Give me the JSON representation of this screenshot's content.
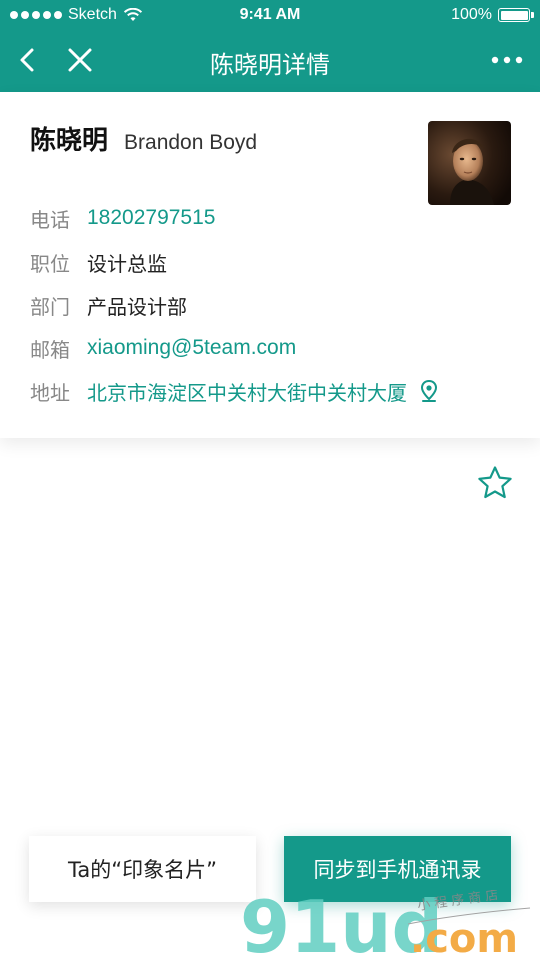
{
  "status_bar": {
    "carrier": "Sketch",
    "time": "9:41 AM",
    "battery": "100%"
  },
  "nav": {
    "title": "陈晓明详情"
  },
  "contact": {
    "name_cn": "陈晓明",
    "name_en": "Brandon Boyd",
    "fields": [
      {
        "label": "电话",
        "value": "18202797515"
      },
      {
        "label": "职位",
        "value": "设计总监"
      },
      {
        "label": "部门",
        "value": "产品设计部"
      },
      {
        "label": "邮箱",
        "value": "xiaoming@5team.com"
      },
      {
        "label": "地址",
        "value": "北京市海淀区中关村大街中关村大厦"
      }
    ]
  },
  "buttons": {
    "card_label": "Ta的“印象名片”",
    "sync_label": "同步到手机通讯录"
  },
  "watermark": {
    "logo": "91ud.com",
    "tagline": "小程序商店"
  },
  "icons": {
    "back": "chevron-left-icon",
    "close": "close-icon",
    "more": "more-dots-icon",
    "location": "location-pin-icon",
    "favorite": "star-outline-icon"
  },
  "colors": {
    "brand": "#14998a",
    "label": "#888888",
    "text": "#222222"
  }
}
